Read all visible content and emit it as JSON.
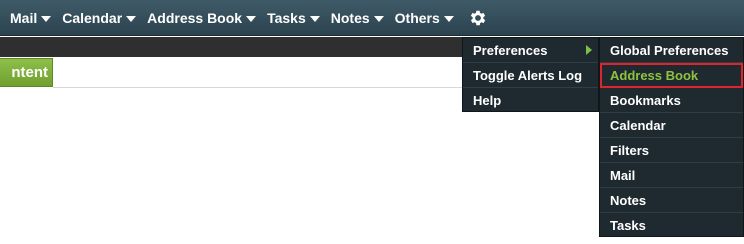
{
  "nav": {
    "items": [
      {
        "label": "Mail"
      },
      {
        "label": "Calendar"
      },
      {
        "label": "Address Book"
      },
      {
        "label": "Tasks"
      },
      {
        "label": "Notes"
      },
      {
        "label": "Others"
      }
    ],
    "settings_icon": "gear-icon"
  },
  "content_tab": {
    "label": "ntent"
  },
  "settings_menu": {
    "items": [
      {
        "label": "Preferences",
        "has_submenu": true
      },
      {
        "label": "Toggle Alerts Log"
      },
      {
        "label": "Help"
      }
    ]
  },
  "preferences_submenu": {
    "items": [
      {
        "label": "Global Preferences"
      },
      {
        "label": "Address Book",
        "highlighted": true
      },
      {
        "label": "Bookmarks"
      },
      {
        "label": "Calendar"
      },
      {
        "label": "Filters"
      },
      {
        "label": "Mail"
      },
      {
        "label": "Notes"
      },
      {
        "label": "Tasks"
      }
    ]
  },
  "colors": {
    "nav_bar": "#2c434f",
    "menu_bg": "#1f2a30",
    "highlight_text": "#8fc23f",
    "highlight_border": "#e0242c",
    "tab_green": "#7cb03a"
  }
}
